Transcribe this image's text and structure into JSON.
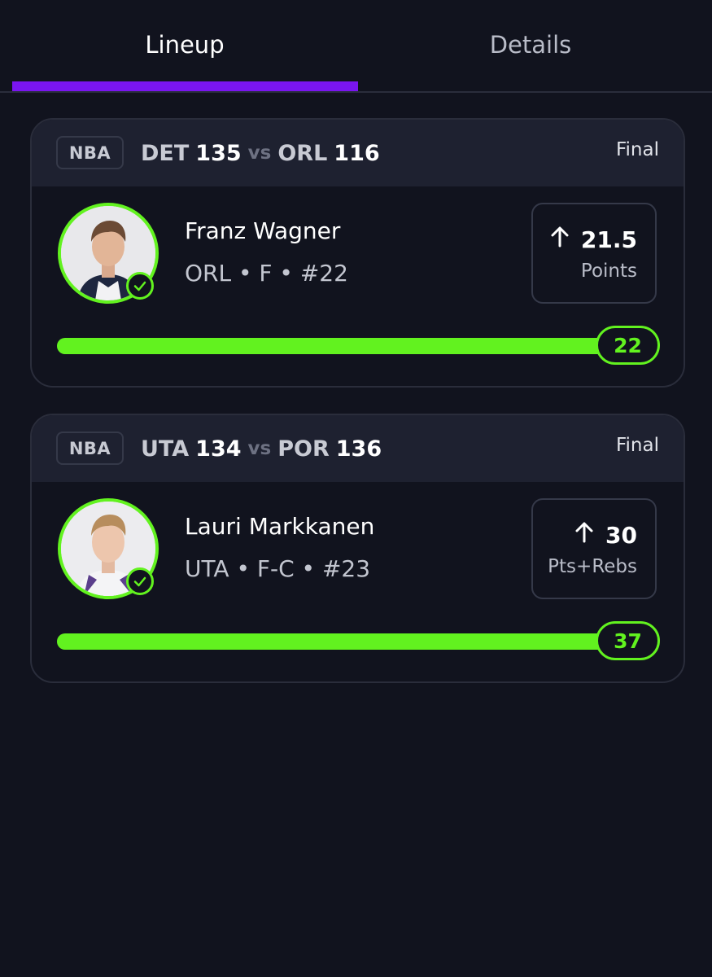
{
  "tabs": [
    {
      "label": "Lineup",
      "active": true
    },
    {
      "label": "Details",
      "active": false
    }
  ],
  "colors": {
    "background": "#11131e",
    "card_header": "#1e2130",
    "accent_purple": "#7a15f0",
    "accent_green": "#62f21f"
  },
  "picks": [
    {
      "league": "NBA",
      "away_team": "DET",
      "away_score": "135",
      "vs": "vs",
      "home_team": "ORL",
      "home_score": "116",
      "status": "Final",
      "player_name": "Franz Wagner",
      "player_meta": "ORL • F • #22",
      "direction_icon": "arrow-up-icon",
      "line": "21.5",
      "stat": "Points",
      "result": "22",
      "progress": 1.0
    },
    {
      "league": "NBA",
      "away_team": "UTA",
      "away_score": "134",
      "vs": "vs",
      "home_team": "POR",
      "home_score": "136",
      "status": "Final",
      "player_name": "Lauri Markkanen",
      "player_meta": "UTA • F-C • #23",
      "direction_icon": "arrow-up-icon",
      "line": "30",
      "stat": "Pts+Rebs",
      "result": "37",
      "progress": 1.0
    }
  ]
}
